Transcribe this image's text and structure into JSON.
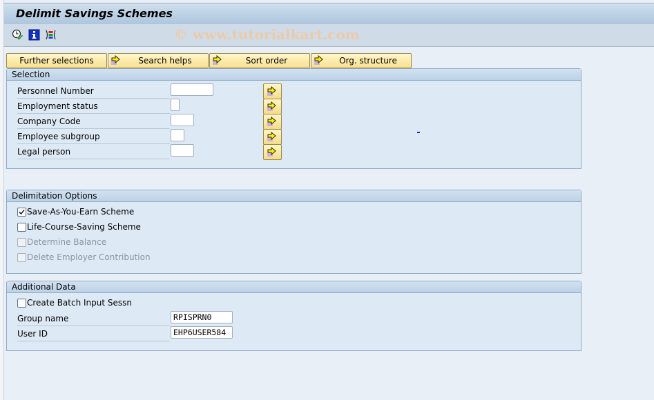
{
  "window": {
    "title": "Delimit Savings Schemes",
    "watermark": "© www.tutorialkart.com"
  },
  "toolbar": {
    "icons": [
      "execute-clock-icon",
      "information-icon",
      "selection-options-icon"
    ]
  },
  "tabs": [
    {
      "label": "Further selections",
      "icon": null
    },
    {
      "label": "Search helps",
      "icon": "arrow-right-icon"
    },
    {
      "label": "Sort order",
      "icon": "arrow-right-icon"
    },
    {
      "label": "Org. structure",
      "icon": "arrow-right-icon"
    }
  ],
  "selection": {
    "title": "Selection",
    "fields": [
      {
        "label": "Personnel Number",
        "value": ""
      },
      {
        "label": "Employment status",
        "value": ""
      },
      {
        "label": "Company Code",
        "value": ""
      },
      {
        "label": "Employee subgroup",
        "value": ""
      },
      {
        "label": "Legal person",
        "value": ""
      }
    ]
  },
  "delimitation": {
    "title": "Delimitation Options",
    "options": [
      {
        "label": "Save-As-You-Earn Scheme",
        "checked": true,
        "enabled": true
      },
      {
        "label": "Life-Course-Saving Scheme",
        "checked": false,
        "enabled": true
      },
      {
        "label": "Determine Balance",
        "checked": false,
        "enabled": false
      },
      {
        "label": "Delete Employer Contribution",
        "checked": false,
        "enabled": false
      }
    ]
  },
  "additional": {
    "title": "Additional Data",
    "batch": {
      "label": "Create Batch Input Sessn",
      "checked": false
    },
    "group_name": {
      "label": "Group name",
      "value": "RPISPRN0"
    },
    "user_id": {
      "label": "User ID",
      "value": "EHP6USER584"
    }
  },
  "colors": {
    "button_bg": "#f8e090",
    "group_bg": "#dde9f4",
    "page_bg": "#e8eff7"
  }
}
